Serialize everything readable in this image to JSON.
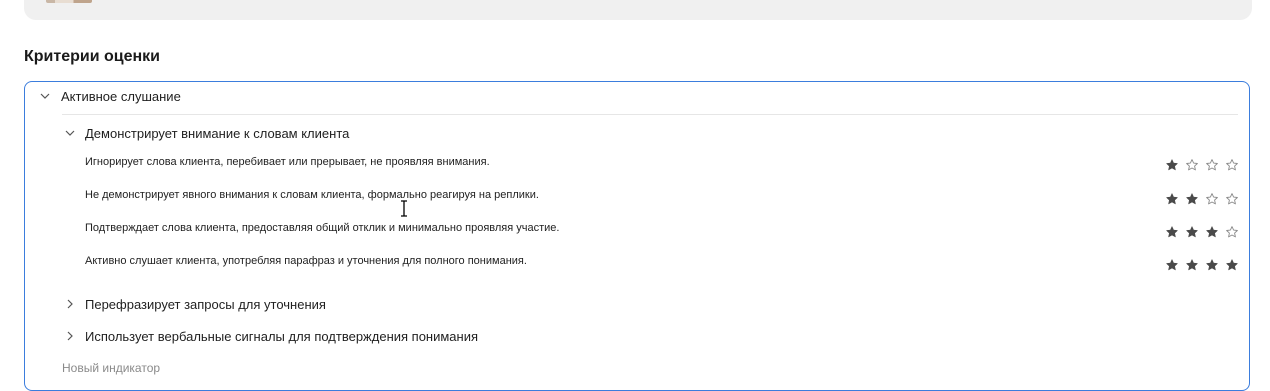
{
  "section": {
    "title": "Критерии оценки"
  },
  "group": {
    "title": "Активное слушание",
    "expanded": true
  },
  "subgroups": [
    {
      "title": "Демонстрирует внимание к словам клиента",
      "expanded": true,
      "criteria": [
        {
          "text": "Игнорирует слова клиента, перебивает или прерывает, не проявляя внимания.",
          "rating": 1,
          "max": 4
        },
        {
          "text": "Не демонстрирует явного внимания к словам клиента, формально реагируя на реплики.",
          "rating": 2,
          "max": 4
        },
        {
          "text": "Подтверждает слова клиента, предоставляя общий отклик и минимально проявляя участие.",
          "rating": 3,
          "max": 4
        },
        {
          "text": "Активно слушает клиента, употребляя парафраз и уточнения для полного понимания.",
          "rating": 4,
          "max": 4
        }
      ]
    },
    {
      "title": "Перефразирует запросы для уточнения",
      "expanded": false
    },
    {
      "title": "Использует вербальные сигналы для подтверждения понимания",
      "expanded": false
    }
  ],
  "new_indicator": {
    "placeholder": "Новый индикатор"
  },
  "colors": {
    "accent_border": "#3b7ddd",
    "star_filled": "#4a4a4a",
    "star_empty": "#8a8a8a",
    "placeholder": "#8a8a8a"
  }
}
